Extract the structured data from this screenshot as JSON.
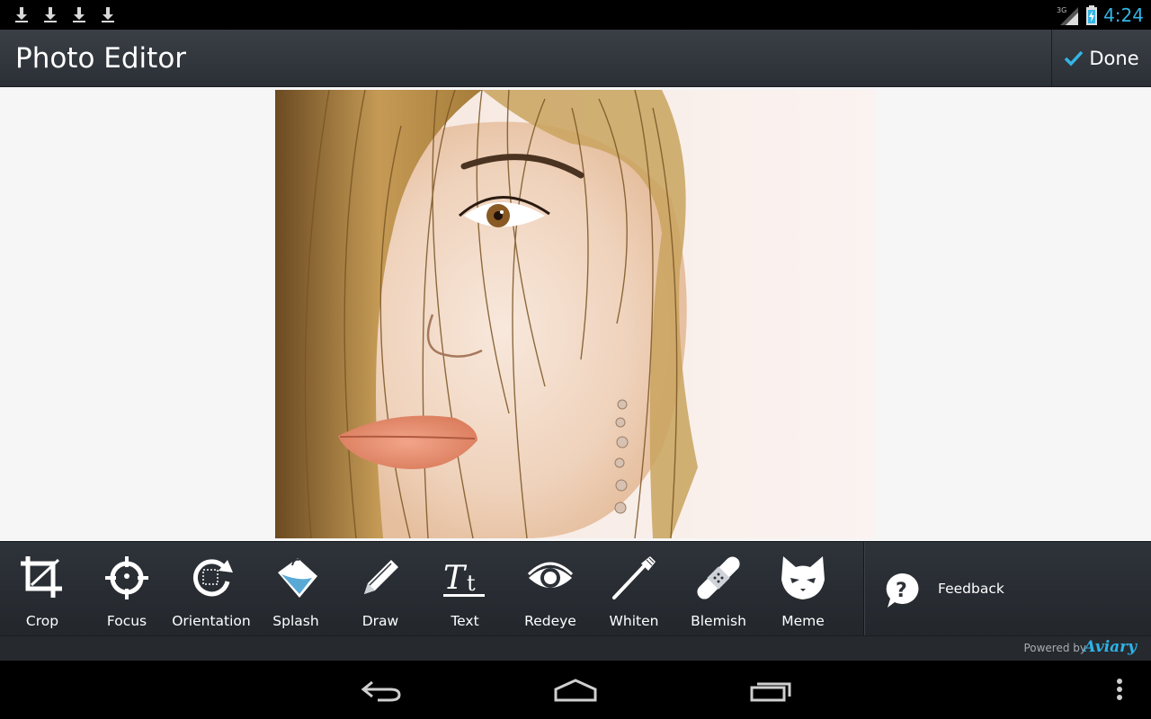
{
  "status_bar": {
    "clock": "4:24",
    "network": "3G",
    "notification_icons": [
      "download-icon",
      "download-icon",
      "download-icon",
      "download-icon"
    ]
  },
  "action_bar": {
    "title": "Photo Editor",
    "done_label": "Done"
  },
  "tools": [
    {
      "id": "crop",
      "label": "Crop",
      "icon": "crop-icon"
    },
    {
      "id": "focus",
      "label": "Focus",
      "icon": "crosshair-icon"
    },
    {
      "id": "orientation",
      "label": "Orientation",
      "icon": "rotate-icon"
    },
    {
      "id": "splash",
      "label": "Splash",
      "icon": "paint-bucket-icon"
    },
    {
      "id": "draw",
      "label": "Draw",
      "icon": "pencil-icon"
    },
    {
      "id": "text",
      "label": "Text",
      "icon": "text-icon"
    },
    {
      "id": "redeye",
      "label": "Redeye",
      "icon": "eye-icon"
    },
    {
      "id": "whiten",
      "label": "Whiten",
      "icon": "toothbrush-icon"
    },
    {
      "id": "blemish",
      "label": "Blemish",
      "icon": "bandage-icon"
    },
    {
      "id": "meme",
      "label": "Meme",
      "icon": "cat-icon"
    }
  ],
  "feedback": {
    "label": "Feedback",
    "icon": "question-bubble-icon"
  },
  "footer": {
    "powered_by": "Powered by",
    "brand": "Aviary"
  },
  "colors": {
    "accent": "#33b5e5",
    "toolbar": "#2b3036",
    "canvas": "#f6f6f6",
    "brand": "#2fb3e8"
  }
}
